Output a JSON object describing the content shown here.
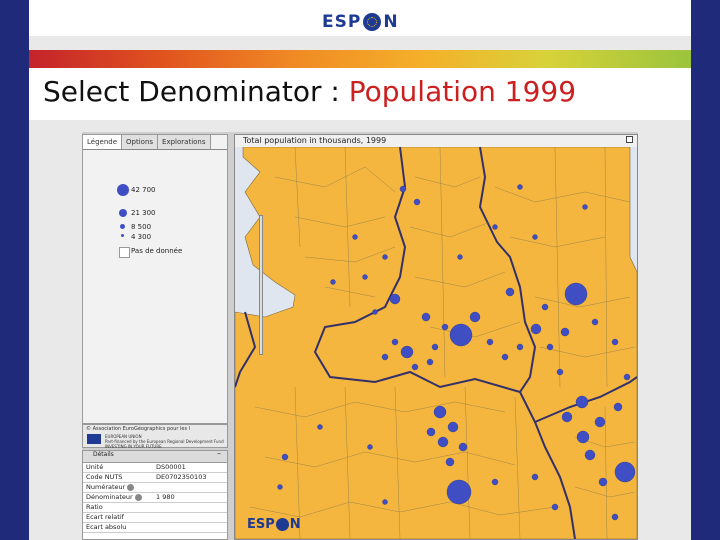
{
  "header": {
    "logo_left": "ESP",
    "logo_right": "N"
  },
  "title": {
    "prefix": "Select Denominator : ",
    "highlight": "Population 1999"
  },
  "app": {
    "tabs": [
      {
        "label": "Légende"
      },
      {
        "label": "Options"
      },
      {
        "label": "Explorations"
      }
    ],
    "legend": {
      "items": [
        {
          "label": "42 700"
        },
        {
          "label": "21 300"
        },
        {
          "label": "8 500"
        },
        {
          "label": "4 300"
        }
      ],
      "nodata": "Pas de donnée"
    },
    "credit": {
      "line1": "© Association EuroGéographics pour les l",
      "eu_text": "EUROPEAN UNION\nPart-financed by the European Regional Development Fund\nINVESTING IN YOUR FUTURE"
    },
    "details": {
      "header": "Détails",
      "rows": [
        {
          "key": "Unité",
          "value": "DS00001"
        },
        {
          "key": "Code NUTS",
          "value": "DE0702350103"
        },
        {
          "key": "Numérateur",
          "value": ""
        },
        {
          "key": "Dénominateur",
          "value": "1 980"
        },
        {
          "key": "Ratio",
          "value": ""
        },
        {
          "key": "Ecart relatif",
          "value": ""
        },
        {
          "key": "Ecart absolu",
          "value": ""
        }
      ]
    },
    "map": {
      "title": "Total population in thousands, 1999",
      "logo_left": "ESP",
      "logo_right": "N",
      "colors": {
        "land": "#f4b63e",
        "sea": "#dfe6f0",
        "border": "#7a6a3a",
        "circle": "#3f4fc3"
      }
    }
  }
}
